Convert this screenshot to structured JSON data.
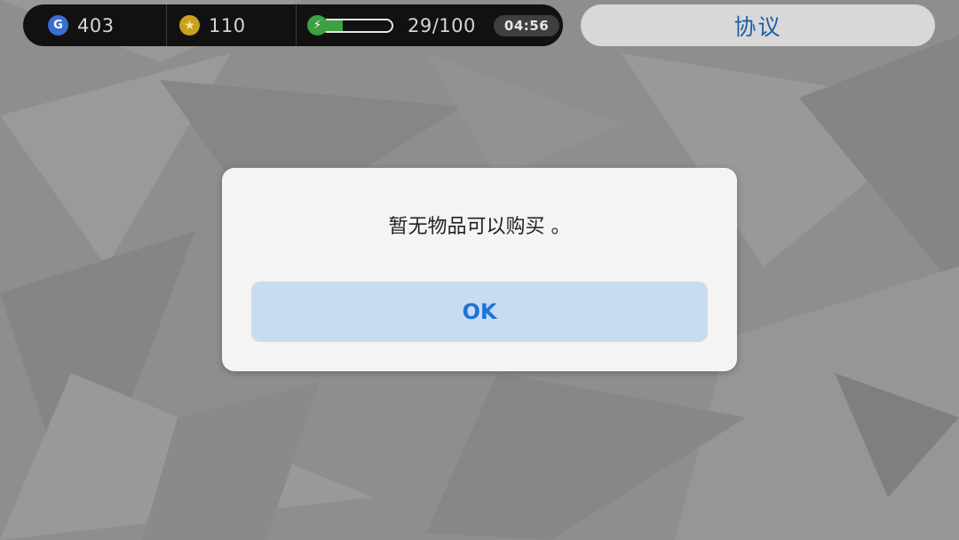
{
  "status_bar": {
    "gems": {
      "icon": "gem-g-icon",
      "glyph": "G",
      "value": "403"
    },
    "coins": {
      "icon": "star-coin-icon",
      "glyph": "★",
      "value": "110"
    },
    "energy": {
      "icon": "lightning-icon",
      "glyph": "⚡",
      "level": 0.29,
      "value": "29/100"
    },
    "timer": "04:56"
  },
  "agreement_button": {
    "label": "协议"
  },
  "dialog": {
    "message": "暂无物品可以购买 。",
    "ok_label": "OK"
  },
  "colors": {
    "background": "#8f8f8f",
    "status_bar": "#111111",
    "energy_green": "#3da044",
    "dialog_bg": "#f4f4f4",
    "ok_button_bg": "#c8dcf1",
    "ok_button_text": "#1e74d8",
    "agreement_text": "#1f5ea8"
  }
}
